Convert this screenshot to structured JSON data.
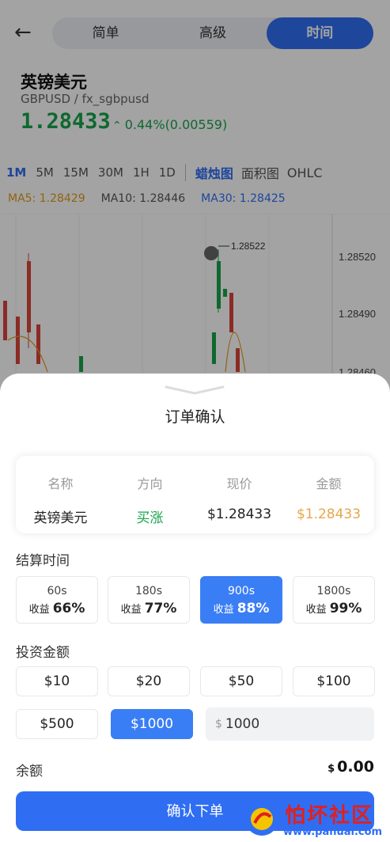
{
  "header": {
    "tabs": [
      {
        "label": "简单",
        "active": false
      },
      {
        "label": "高级",
        "active": false
      },
      {
        "label": "时间",
        "active": true
      }
    ]
  },
  "asset": {
    "name": "英镑美元",
    "symbol": "GBPUSD / fx_sgbpusd",
    "price": "1.28433",
    "change": "0.44%(0.00559)"
  },
  "chart_controls": {
    "timeframes": [
      "1M",
      "5M",
      "15M",
      "30M",
      "1H",
      "1D"
    ],
    "chart_types": [
      "蜡烛图",
      "面积图",
      "OHLC"
    ],
    "ma5": "MA5: 1.28429",
    "ma10": "MA10: 1.28446",
    "ma30": "MA30: 1.28425",
    "y_ticks": [
      "1.28520",
      "1.28490",
      "1.28460"
    ],
    "marker_label": "1.28522"
  },
  "order_sheet": {
    "title": "订单确认",
    "columns": [
      {
        "header": "名称",
        "value": "英镑美元"
      },
      {
        "header": "方向",
        "value": "买涨"
      },
      {
        "header": "现价",
        "value": "$1.28433"
      },
      {
        "header": "金额",
        "value": "$1.28433"
      }
    ],
    "settlement_label": "结算时间",
    "durations": [
      {
        "time": "60s",
        "profit_label": "收益",
        "profit": "66%"
      },
      {
        "time": "180s",
        "profit_label": "收益",
        "profit": "77%"
      },
      {
        "time": "900s",
        "profit_label": "收益",
        "profit": "88%"
      },
      {
        "time": "1800s",
        "profit_label": "收益",
        "profit": "99%"
      }
    ],
    "investment_label": "投资金额",
    "amounts": [
      "$10",
      "$20",
      "$50",
      "$100",
      "$500",
      "$1000"
    ],
    "currency_symbol": "$",
    "custom_amount": "1000",
    "balance_label": "余额",
    "balance_value": "0.00",
    "confirm_label": "确认下单"
  },
  "watermark": {
    "text": "怕坏社区",
    "url": "www.pahuai.com"
  },
  "colors": {
    "accent": "#2f6ef3",
    "up_green": "#18a34a",
    "amount_orange": "#e8a64a"
  }
}
